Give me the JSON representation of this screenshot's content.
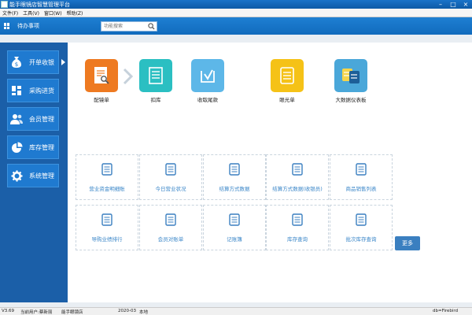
{
  "window": {
    "title": "能手眼镜店智慧管理平台",
    "controls": [
      "–",
      "□",
      "×"
    ]
  },
  "menu": [
    "文件(F)",
    "工具(V)",
    "窗口(W)",
    "帮助(Z)"
  ],
  "toolbar": {
    "todo_label": "待办事项",
    "search_placeholder": "功能搜索",
    "icons": {
      "grid": "grid-icon",
      "search": "search-icon"
    }
  },
  "sidebar": {
    "items": [
      {
        "label": "开单收银",
        "icon": "money-bag-icon"
      },
      {
        "label": "采购进货",
        "icon": "blocks-icon"
      },
      {
        "label": "会员管理",
        "icon": "users-icon"
      },
      {
        "label": "库存管理",
        "icon": "pie-chart-icon"
      },
      {
        "label": "系统管理",
        "icon": "gear-icon"
      }
    ]
  },
  "flow": [
    {
      "label": "配镜单",
      "color": "#ee7a21",
      "icon": "prescription-doc-icon"
    },
    {
      "label": "扣库",
      "color": "#2bbfc2",
      "icon": "doc-list-icon"
    },
    {
      "label": "收取尾款",
      "color": "#5db7e8",
      "icon": "download-tray-icon"
    },
    {
      "label": "眼光单",
      "color": "#f5c217",
      "icon": "doc-yellow-icon"
    },
    {
      "label": "大数据仪表板",
      "color": "#4aa7d9",
      "icon": "dashboard-docs-icon"
    }
  ],
  "reports_row1": [
    "营业资金明细账",
    "今日营业状况",
    "结算方式数据",
    "结算方式数据(收银员)",
    "商品销售列表"
  ],
  "reports_row2": [
    "导购业绩排行",
    "会员对账单",
    "记账簿",
    "库存查询",
    "批次库存查询"
  ],
  "more_label": "更多",
  "status": {
    "version": "V3.69",
    "user": "当前用户:蔡新丽",
    "store": "能手眼镜店",
    "date": "2020-03",
    "location": "本地",
    "db": "db=Firebird"
  }
}
